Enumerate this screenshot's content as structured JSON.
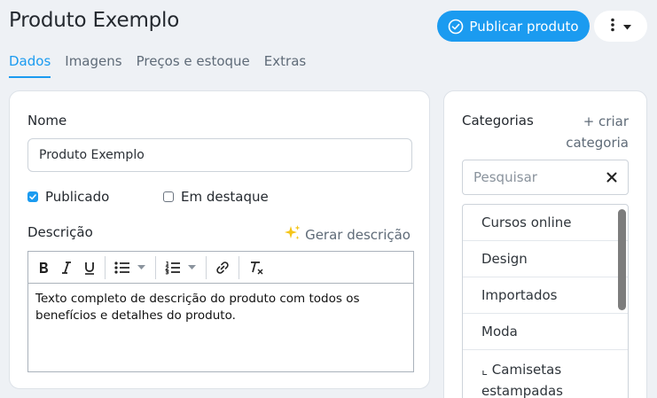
{
  "header": {
    "title": "Produto Exemplo",
    "publish_label": "Publicar produto"
  },
  "tabs": [
    {
      "label": "Dados",
      "active": true
    },
    {
      "label": "Imagens",
      "active": false
    },
    {
      "label": "Preços e estoque",
      "active": false
    },
    {
      "label": "Extras",
      "active": false
    }
  ],
  "form": {
    "name_label": "Nome",
    "name_value": "Produto Exemplo",
    "published_label": "Publicado",
    "published_checked": true,
    "featured_label": "Em destaque",
    "featured_checked": false,
    "description_label": "Descrição",
    "generate_label": "Gerar descrição",
    "description_text": "Texto completo de descrição do produto com todos os benefícios e detalhes do produto."
  },
  "categories": {
    "title": "Categorias",
    "create_label_line1": "+ criar",
    "create_label_line2": "categoria",
    "search_placeholder": "Pesquisar",
    "items": [
      {
        "label": "Cursos online"
      },
      {
        "label": "Design"
      },
      {
        "label": "Importados"
      },
      {
        "label": "Moda"
      },
      {
        "label": "⌞ Camisetas estampadas"
      }
    ]
  },
  "colors": {
    "accent": "#1b9bf0",
    "background": "#eef1f5"
  }
}
